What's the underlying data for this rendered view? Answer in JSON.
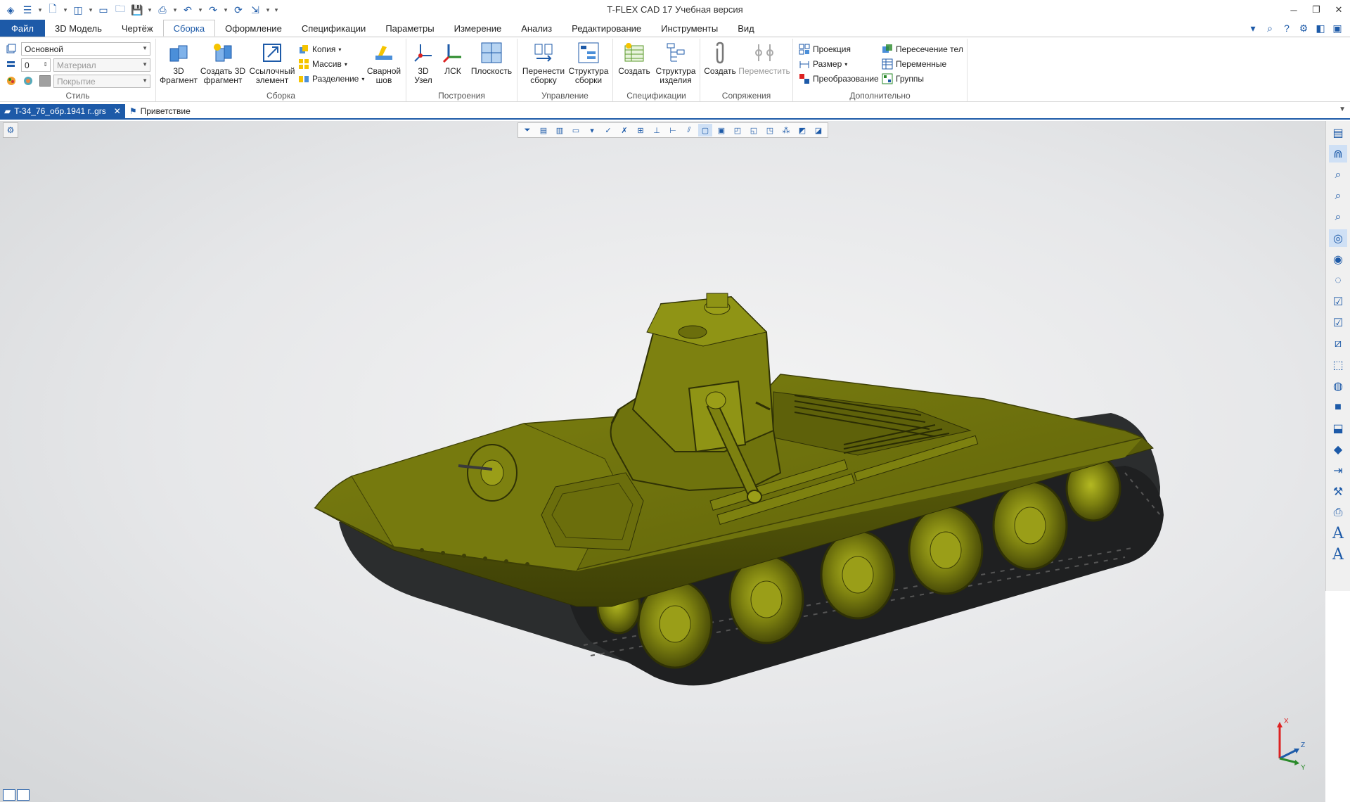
{
  "window": {
    "title": "T-FLEX CAD 17 Учебная версия"
  },
  "tabs": [
    {
      "label": "Файл",
      "type": "file"
    },
    {
      "label": "3D Модель"
    },
    {
      "label": "Чертёж"
    },
    {
      "label": "Сборка",
      "active": true
    },
    {
      "label": "Оформление"
    },
    {
      "label": "Спецификации"
    },
    {
      "label": "Параметры"
    },
    {
      "label": "Измерение"
    },
    {
      "label": "Анализ"
    },
    {
      "label": "Редактирование"
    },
    {
      "label": "Инструменты"
    },
    {
      "label": "Вид"
    }
  ],
  "ribbon": {
    "style": {
      "label": "Стиль",
      "layer": "Основной",
      "level": "0",
      "material_placeholder": "Материал",
      "coating_placeholder": "Покрытие"
    },
    "assembly": {
      "label": "Сборка",
      "fragment": "3D\nФрагмент",
      "create_fragment": "Создать 3D\nфрагмент",
      "ref_element": "Ссылочный\nэлемент",
      "copy": "Копия",
      "array": "Массив",
      "split": "Разделение",
      "weld": "Сварной\nшов"
    },
    "construct": {
      "label": "Построения",
      "node": "3D\nУзел",
      "lcs": "ЛСК",
      "plane": "Плоскость"
    },
    "manage": {
      "label": "Управление",
      "move_assembly": "Перенести\nсборку",
      "assembly_structure": "Структура\nсборки"
    },
    "specs": {
      "label": "Спецификации",
      "create": "Создать",
      "product_structure": "Структура\nизделия"
    },
    "mates": {
      "label": "Сопряжения",
      "create": "Создать",
      "move": "Переместить"
    },
    "extra": {
      "label": "Дополнительно",
      "projection": "Проекция",
      "dimension": "Размер",
      "transform": "Преобразование",
      "intersection": "Пересечение тел",
      "variables": "Переменные",
      "groups": "Группы"
    }
  },
  "doc_tabs": [
    {
      "label": "T-34_76_обр.1941 г..grs",
      "active": true
    },
    {
      "label": "Приветствие"
    }
  ],
  "axes": {
    "x": "X",
    "y": "Y",
    "z": "Z"
  },
  "colors": {
    "accent": "#1d5aa8",
    "tank_hull": "#6b6e0c",
    "tank_light": "#8f9415",
    "tank_dark": "#3e4006",
    "track": "#2b2d2e"
  }
}
